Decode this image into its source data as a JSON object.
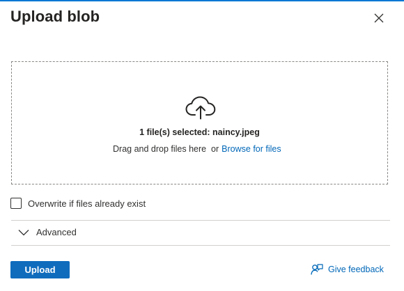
{
  "panel": {
    "title": "Upload blob",
    "accent_color": "#0078d4"
  },
  "dropzone": {
    "icon": "cloud-upload-icon",
    "selected_text": "1 file(s) selected: naincy.jpeg",
    "drag_text": "Drag and drop files here  or",
    "browse_label": "Browse for files"
  },
  "options": {
    "overwrite_label": "Overwrite if files already exist",
    "overwrite_checked": false
  },
  "advanced": {
    "label": "Advanced",
    "expanded": false
  },
  "footer": {
    "upload_label": "Upload",
    "upload_color": "#0f6cbd",
    "feedback_label": "Give feedback",
    "feedback_icon": "feedback-icon"
  },
  "icons": {
    "close": "close-icon",
    "chevron": "chevron-down-icon"
  }
}
